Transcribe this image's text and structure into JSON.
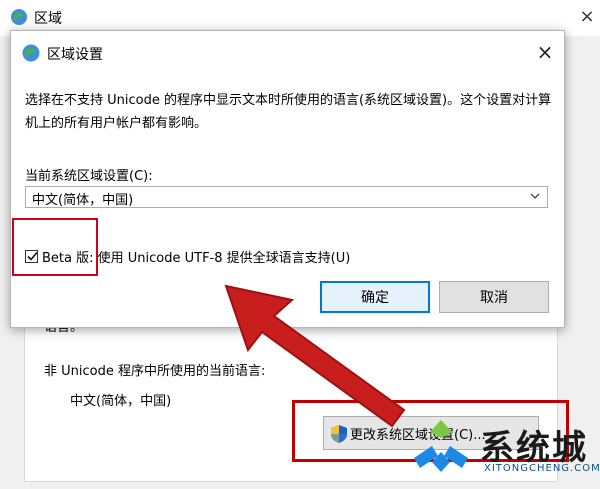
{
  "background_window": {
    "title": "区域",
    "close": "×",
    "partial_text": "语言。",
    "current_language_label": "非 Unicode 程序中所使用的当前语言:",
    "current_language_value": "中文(简体，中国)",
    "change_button_label": "更改系统区域设置(C)..."
  },
  "dialog": {
    "title": "区域设置",
    "close": "×",
    "description": "选择在不支持 Unicode 的程序中显示文本时所使用的语言(系统区域设置)。这个设置对计算机上的所有用户帐户都有影响。",
    "current_locale_label": "当前系统区域设置(C):",
    "current_locale_value": "中文(简体，中国)",
    "beta_checkbox_label": "Beta 版: 使用 Unicode UTF-8 提供全球语言支持(U)",
    "beta_checked": true,
    "ok_label": "确定",
    "cancel_label": "取消"
  },
  "watermark": {
    "brand": "系统城",
    "url": "XITONGCHENG.COM"
  },
  "colors": {
    "highlight_red": "#d0021b",
    "arrow_red": "#c00000",
    "ok_border": "#0078d7"
  }
}
